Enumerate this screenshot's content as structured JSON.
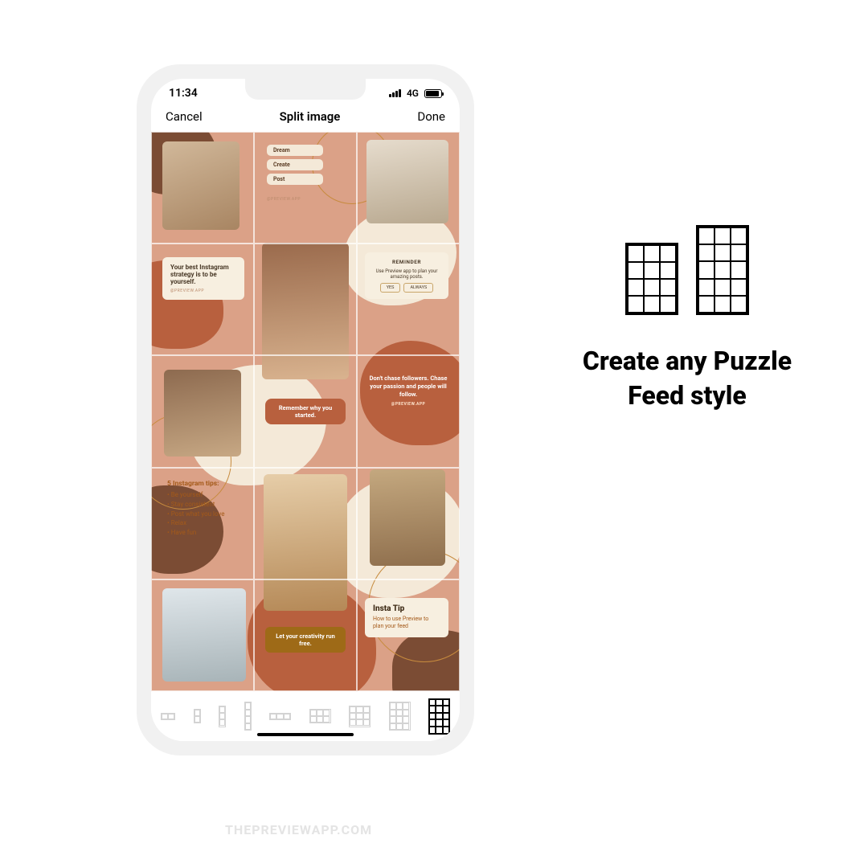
{
  "status": {
    "time": "11:34",
    "network": "4G"
  },
  "nav": {
    "cancel": "Cancel",
    "title": "Split image",
    "done": "Done"
  },
  "feed": {
    "chips": [
      "Dream",
      "Create",
      "Post"
    ],
    "handle": "@PREVIEW.APP",
    "quote1": "Your best Instagram strategy is to be yourself.",
    "reminder_title": "REMINDER",
    "reminder_body": "Use Preview app to plan your amazing posts.",
    "reminder_yes": "YES",
    "reminder_always": "ALWAYS",
    "quote2": "Remember why you started.",
    "quote3": "Don't chase followers. Chase your passion and people will follow.",
    "tips_title": "5 Instagram tips:",
    "tips": [
      "Be yourself",
      "Stay consistent",
      "Post what you love",
      "Relax",
      "Have fun"
    ],
    "quote4": "Let your creativity run free.",
    "tip_card_title": "Insta Tip",
    "tip_card_body": "How to use Preview to plan your feed"
  },
  "layout_options": [
    {
      "cols": 2,
      "rows": 1
    },
    {
      "cols": 1,
      "rows": 2
    },
    {
      "cols": 1,
      "rows": 3
    },
    {
      "cols": 1,
      "rows": 4
    },
    {
      "cols": 3,
      "rows": 1
    },
    {
      "cols": 3,
      "rows": 2
    },
    {
      "cols": 3,
      "rows": 3
    },
    {
      "cols": 3,
      "rows": 4
    },
    {
      "cols": 3,
      "rows": 5,
      "selected": true
    }
  ],
  "right": {
    "tagline": "Create any Puzzle Feed style"
  },
  "watermark": "THEPREVIEWAPP.COM",
  "colors": {
    "base": "#dba187",
    "rust": "#b8603e",
    "brown": "#7b4c34",
    "cream": "#f4e9d8",
    "gold": "#c78b3e"
  }
}
